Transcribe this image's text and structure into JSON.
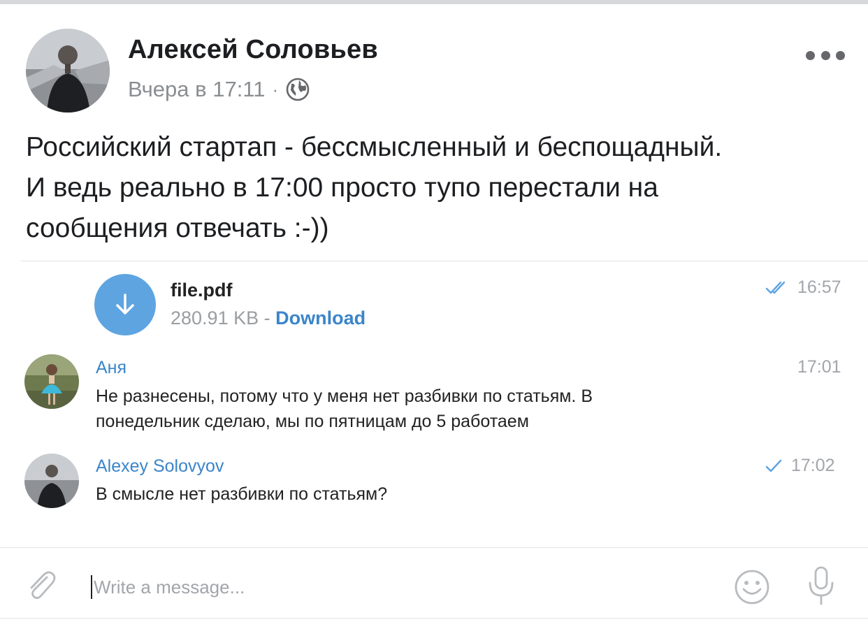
{
  "post": {
    "author_name": "Алексей Соловьев",
    "timestamp": "Вчера в 17:11",
    "separator": "·",
    "privacy_icon": "globe-icon",
    "more_icon": "more-dots-icon",
    "text_lines": [
      "Российский стартап - бессмысленный и беспощадный.",
      "И ведь реально в 17:00 просто тупо перестали на",
      "сообщения отвечать :-))"
    ]
  },
  "chat": {
    "file": {
      "icon": "download-arrow-icon",
      "name": "file.pdf",
      "size": "280.91 KB",
      "separator": " - ",
      "action": "Download",
      "time": "16:57",
      "status_icon": "double-check-icon"
    },
    "messages": [
      {
        "sender": "Аня",
        "time": "17:01",
        "lines": [
          "Не разнесены, потому что у меня нет разбивки по статьям. В",
          "понедельник сделаю, мы по пятницам до 5 работаем"
        ]
      },
      {
        "sender": "Alexey Solovyov",
        "time": "17:02",
        "status_icon": "single-check-icon",
        "lines": [
          "В смысле нет разбивки по статьям?"
        ]
      }
    ],
    "composer": {
      "placeholder": "Write a message...",
      "attach_icon": "paperclip-icon",
      "emoji_icon": "smiley-icon",
      "mic_icon": "microphone-icon"
    }
  },
  "colors": {
    "accent_blue": "#3b85c9",
    "download_circle": "#5ea4e1",
    "muted_text": "#8a8d91"
  }
}
